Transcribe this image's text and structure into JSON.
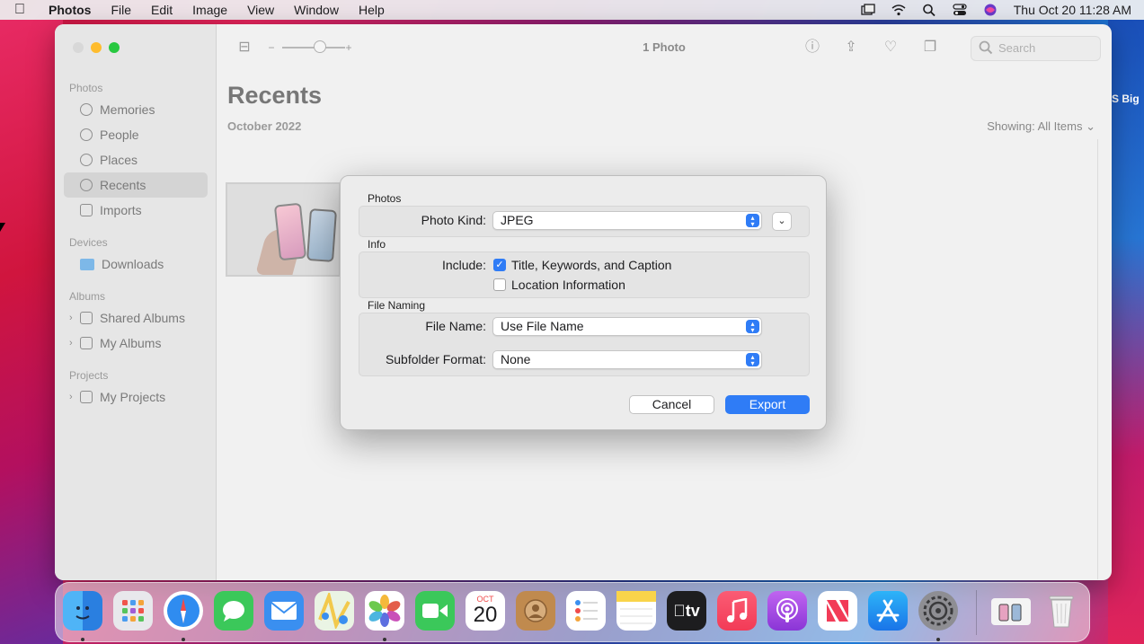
{
  "menubar": {
    "app": "Photos",
    "items": [
      "File",
      "Edit",
      "Image",
      "View",
      "Window",
      "Help"
    ],
    "clock": "Thu Oct 20  11:28 AM"
  },
  "wallpaper": {
    "text": "S Big"
  },
  "window": {
    "toolbar": {
      "title": "1 Photo",
      "search_placeholder": "Search",
      "zoom_minus": "−",
      "zoom_plus": "+"
    },
    "sidebar": {
      "sections": [
        {
          "title": "Photos",
          "items": [
            "Memories",
            "People",
            "Places",
            "Recents",
            "Imports"
          ]
        },
        {
          "title": "Devices",
          "items": [
            "Downloads"
          ]
        },
        {
          "title": "Albums",
          "items": [
            "Shared Albums",
            "My Albums"
          ]
        },
        {
          "title": "Projects",
          "items": [
            "My Projects"
          ]
        }
      ],
      "selected": "Recents"
    },
    "content": {
      "title": "Recents",
      "date": "October 2022",
      "showing": "Showing: All Items"
    }
  },
  "dialog": {
    "photos_section": "Photos",
    "photo_kind_label": "Photo Kind:",
    "photo_kind_value": "JPEG",
    "info_section": "Info",
    "include_label": "Include:",
    "include_options": [
      {
        "label": "Title, Keywords, and Caption",
        "checked": true
      },
      {
        "label": "Location Information",
        "checked": false
      }
    ],
    "file_naming_section": "File Naming",
    "file_name_label": "File Name:",
    "file_name_value": "Use File Name",
    "subfolder_label": "Subfolder Format:",
    "subfolder_value": "None",
    "cancel": "Cancel",
    "export": "Export"
  },
  "dock": {
    "calendar_month": "OCT",
    "calendar_day": "20",
    "tv_label": "tv",
    "apps": [
      "Finder",
      "Launchpad",
      "Safari",
      "Messages",
      "Mail",
      "Maps",
      "Photos",
      "FaceTime",
      "Calendar",
      "Contacts",
      "Reminders",
      "Notes",
      "TV",
      "Music",
      "Podcasts",
      "News",
      "App Store",
      "System Preferences",
      "Downloads Stack",
      "Trash"
    ]
  },
  "colors": {
    "accent": "#2f7cf6",
    "window_bg": "#f1f1f1",
    "sidebar_bg": "#e6e6e6"
  }
}
